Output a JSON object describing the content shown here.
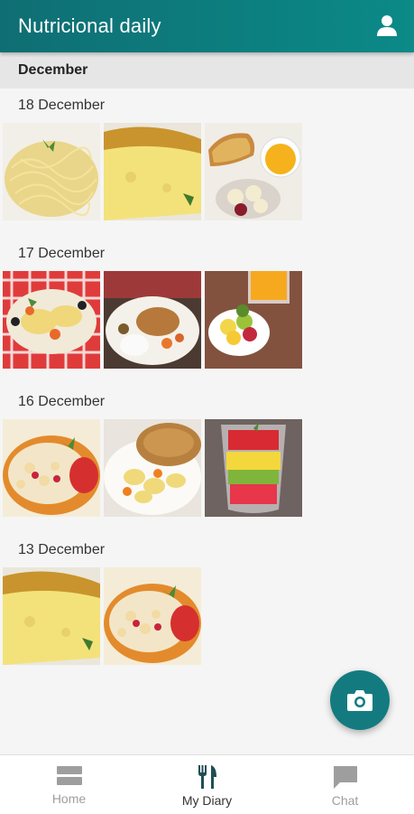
{
  "app": {
    "title": "Nutricional daily"
  },
  "month": "December",
  "days": [
    {
      "label": "18 December"
    },
    {
      "label": "17 December"
    },
    {
      "label": "16 December"
    },
    {
      "label": "13 December"
    }
  ],
  "bottom_nav": [
    {
      "label": "Home",
      "icon": "home-icon"
    },
    {
      "label": "My Diary",
      "icon": "cutlery-icon"
    },
    {
      "label": "Chat",
      "icon": "chat-icon"
    }
  ],
  "colors": {
    "primary": "#0f6e73",
    "accent": "#137b80"
  }
}
